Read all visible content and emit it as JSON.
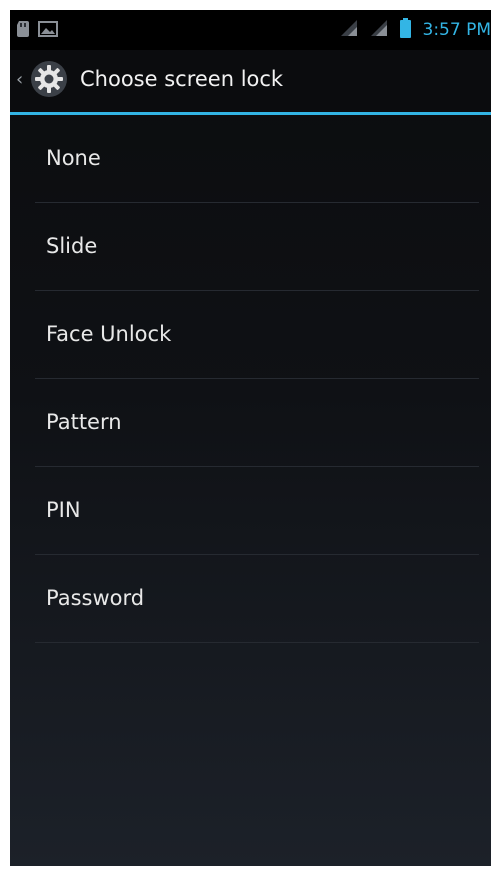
{
  "status_bar": {
    "time": "3:57 PM",
    "left_icons": [
      "sd-card-icon",
      "image-notification-icon"
    ],
    "right_icons": [
      "wifi-signal-icon",
      "cell-signal-icon",
      "battery-icon"
    ],
    "time_color": "#33b5e5"
  },
  "action_bar": {
    "title": "Choose screen lock",
    "icon": "settings-gear-icon",
    "accent_color": "#33b5e5"
  },
  "lock_options": [
    {
      "label": "None"
    },
    {
      "label": "Slide"
    },
    {
      "label": "Face Unlock"
    },
    {
      "label": "Pattern"
    },
    {
      "label": "PIN"
    },
    {
      "label": "Password"
    }
  ]
}
